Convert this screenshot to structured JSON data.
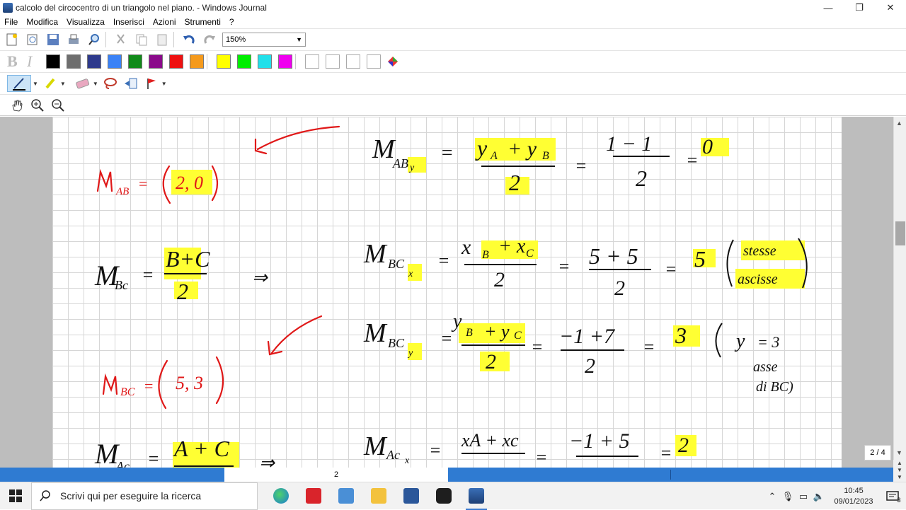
{
  "window": {
    "title": "calcolo del circocentro di un triangolo nel piano. - Windows Journal",
    "minimize": "—",
    "restore": "❐",
    "close": "✕"
  },
  "menu": [
    "File",
    "Modifica",
    "Visualizza",
    "Inserisci",
    "Azioni",
    "Strumenti",
    "?"
  ],
  "toolbar": {
    "zoom_value": "150%",
    "bold_label": "B",
    "italic_label": "I",
    "colors": [
      "#000000",
      "#6e6e6e",
      "#2e3a8c",
      "#3b82f6",
      "#118a1a",
      "#8a0a8a",
      "#ee1111",
      "#f59a1c",
      "#ffff00",
      "#00ee00",
      "#22e0ea",
      "#f000f0"
    ]
  },
  "page": {
    "indicator": "2 / 4",
    "number": "2"
  },
  "taskbar": {
    "search_placeholder": "Scrivi qui per eseguire la ricerca",
    "time": "10:45",
    "date": "09/01/2023",
    "notifications": "3"
  }
}
